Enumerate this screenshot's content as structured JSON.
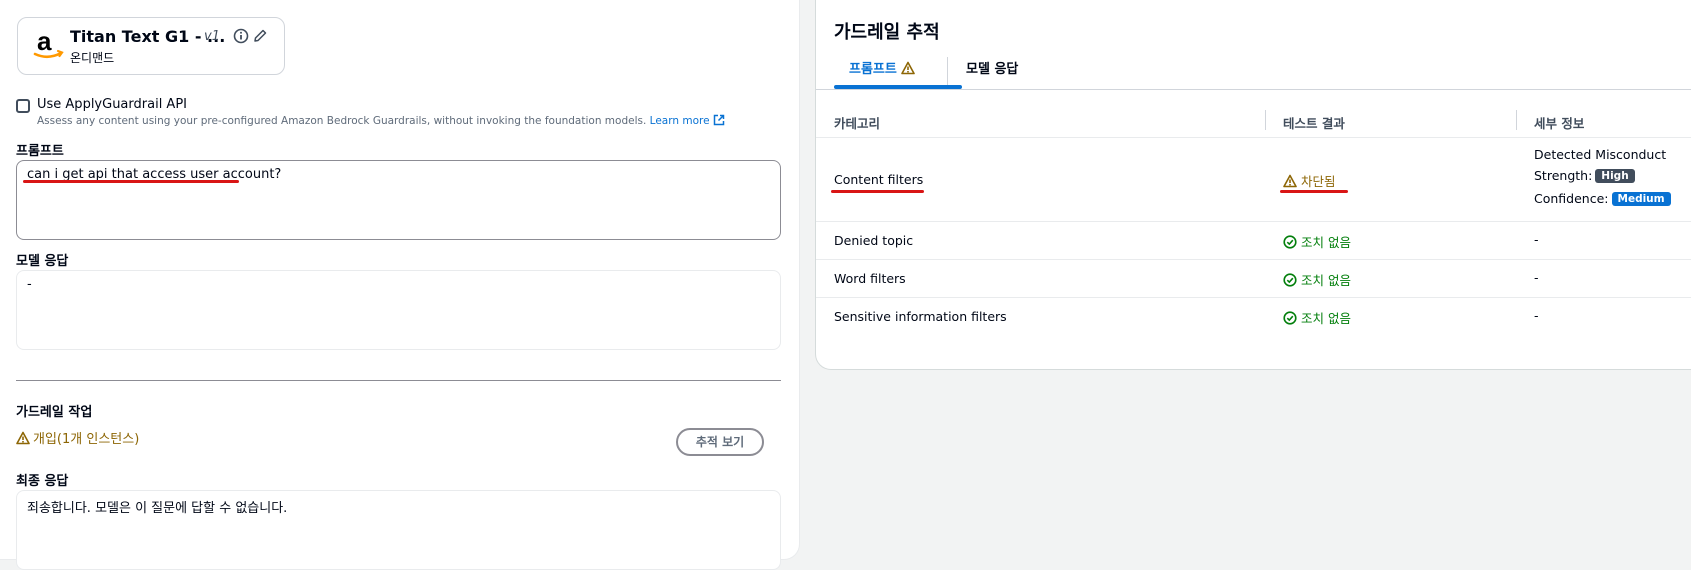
{
  "model": {
    "name": "Titan Text G1 - ...",
    "version": "v1",
    "mode": "온디맨드"
  },
  "apply_guardrail": {
    "checkbox_label": "Use ApplyGuardrail API",
    "description": "Assess any content using your pre-configured Amazon Bedrock Guardrails, without invoking the foundation models.",
    "learn_more": "Learn more",
    "checked": false
  },
  "prompt": {
    "label": "프롬프트",
    "value": "can i get api that access user account?"
  },
  "model_response": {
    "label": "모델 응답",
    "value": "-"
  },
  "guardrail_action": {
    "label": "가드레일 작업",
    "status": "개입(1개 인스턴스)",
    "trace_button": "추적 보기"
  },
  "final_response": {
    "label": "최종 응답",
    "value": "죄송합니다. 모델은 이 질문에 답할 수 없습니다."
  },
  "trace": {
    "title": "가드레일 추적",
    "tabs": [
      {
        "label": "프롬프트",
        "active": true
      },
      {
        "label": "모델 응답",
        "active": false
      }
    ],
    "columns": [
      "카테고리",
      "테스트 결과",
      "세부 정보"
    ],
    "rows": [
      {
        "category": "Content filters",
        "result": "차단됨",
        "status": "blocked",
        "details_title": "Detected Misconduct",
        "strength_label": "Strength:",
        "strength_value": "High",
        "confidence_label": "Confidence:",
        "confidence_value": "Medium"
      },
      {
        "category": "Denied topic",
        "result": "조치 없음",
        "status": "ok",
        "details": "-"
      },
      {
        "category": "Word filters",
        "result": "조치 없음",
        "status": "ok",
        "details": "-"
      },
      {
        "category": "Sensitive information filters",
        "result": "조치 없음",
        "status": "ok",
        "details": "-"
      }
    ]
  },
  "colors": {
    "accent": "#0972d3",
    "success": "#037f0c",
    "warning": "#8d6605",
    "annotation": "#d91515"
  },
  "icons": [
    "amazon-logo",
    "info-icon",
    "edit-icon",
    "external-link-icon",
    "warning-icon",
    "check-circle-icon"
  ]
}
